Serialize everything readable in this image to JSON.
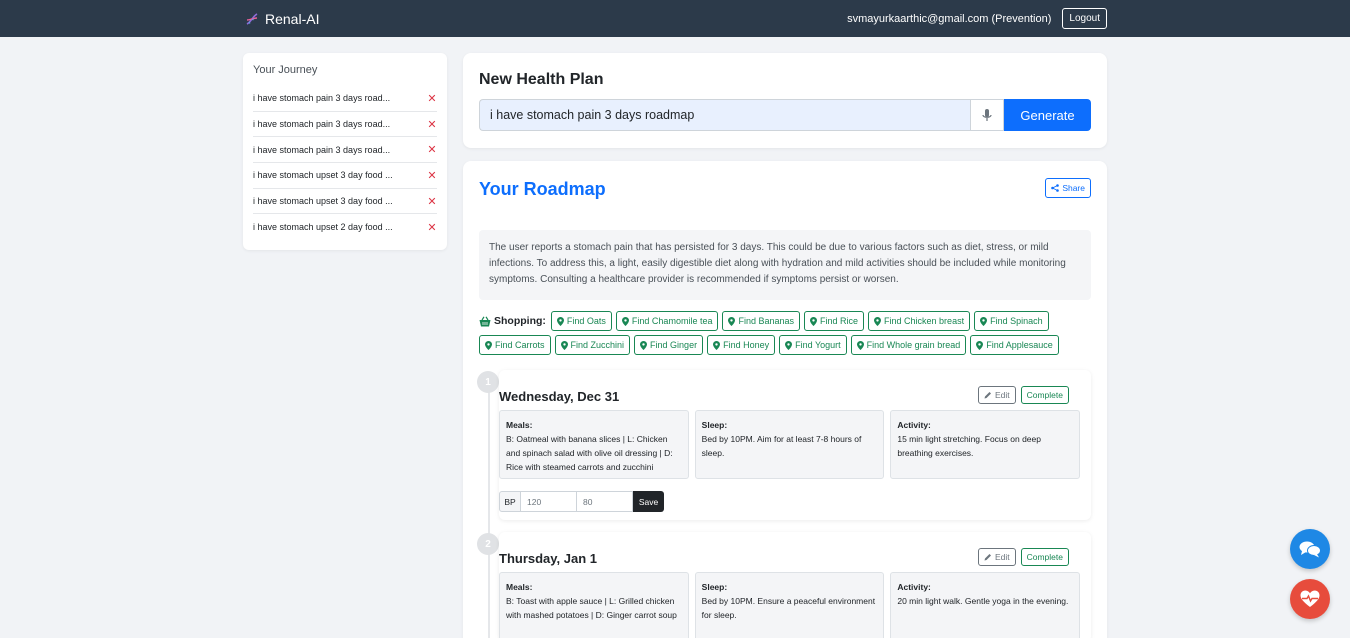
{
  "app": {
    "brand": "Renal-AI"
  },
  "nav": {
    "user_email": "svmayurkaarthic@gmail.com (Prevention)",
    "logout_label": "Logout"
  },
  "sidebar": {
    "title": "Your Journey",
    "items": [
      {
        "label": "i have stomach pain 3 days road..."
      },
      {
        "label": "i have stomach pain 3 days road..."
      },
      {
        "label": "i have stomach pain 3 days road..."
      },
      {
        "label": "i have stomach upset 3 day food ..."
      },
      {
        "label": "i have stomach upset 3 day food ..."
      },
      {
        "label": "i have stomach upset 2 day food ..."
      }
    ],
    "delete_glyph": "✕"
  },
  "plan": {
    "title": "New Health Plan",
    "input_value": "i have stomach pain 3 days roadmap",
    "generate_label": "Generate"
  },
  "roadmap": {
    "title": "Your Roadmap",
    "share_label": "Share",
    "summary": "The user reports a stomach pain that has persisted for 3 days. This could be due to various factors such as diet, stress, or mild infections. To address this, a light, easily digestible diet along with hydration and mild activities should be included while monitoring symptoms. Consulting a healthcare provider is recommended if symptoms persist or worsen.",
    "shopping_label": "Shopping:",
    "shopping_items": [
      "Find Oats",
      "Find Chamomile tea",
      "Find Bananas",
      "Find Rice",
      "Find Chicken breast",
      "Find Spinach",
      "Find Carrots",
      "Find Zucchini",
      "Find Ginger",
      "Find Honey",
      "Find Yogurt",
      "Find Whole grain bread",
      "Find Applesauce"
    ]
  },
  "days": [
    {
      "num": "1",
      "title": "Wednesday, Dec 31",
      "edit_label": "Edit",
      "complete_label": "Complete",
      "meals_label": "Meals:",
      "meals": "B: Oatmeal with banana slices | L: Chicken and spinach salad with olive oil dressing | D: Rice with steamed carrots and zucchini",
      "sleep_label": "Sleep:",
      "sleep": "Bed by 10PM. Aim for at least 7-8 hours of sleep.",
      "activity_label": "Activity:",
      "activity": "15 min light stretching. Focus on deep breathing exercises.",
      "bp_label": "BP",
      "bp_systolic_placeholder": "120",
      "bp_diastolic_placeholder": "80",
      "save_label": "Save"
    },
    {
      "num": "2",
      "title": "Thursday, Jan 1",
      "edit_label": "Edit",
      "complete_label": "Complete",
      "meals_label": "Meals:",
      "meals": "B: Toast with apple sauce | L: Grilled chicken with mashed potatoes | D: Ginger carrot soup",
      "sleep_label": "Sleep:",
      "sleep": "Bed by 10PM. Ensure a peaceful environment for sleep.",
      "activity_label": "Activity:",
      "activity": "20 min light walk. Gentle yoga in the evening."
    }
  ],
  "colors": {
    "navbar": "#2c3a4a",
    "primary": "#0d6efd",
    "success": "#198754",
    "danger": "#dc3545",
    "chat_fab": "#1e88e5",
    "health_fab": "#e74c3c"
  }
}
